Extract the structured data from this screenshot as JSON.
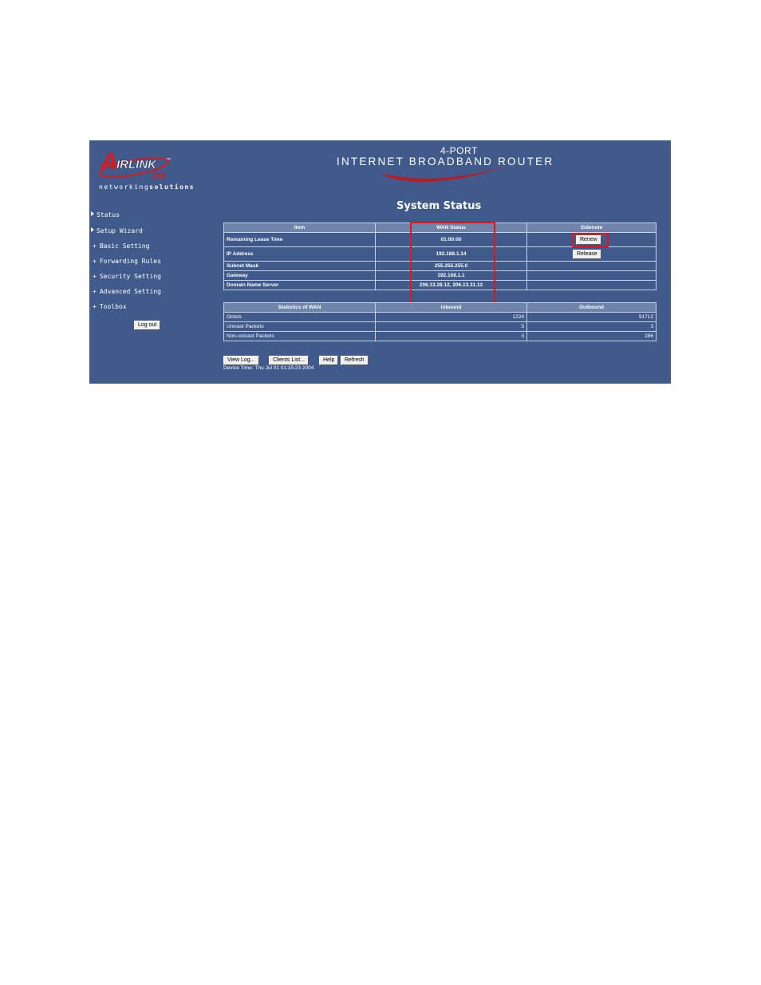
{
  "brand": {
    "logo_letters_a": "A",
    "logo_letters_irlink": "IRLINK",
    "logo_tm": "™",
    "logo_num": "101",
    "tagline_prefix": "networking",
    "tagline_suffix": "solutions",
    "banner_small": "4-PORT",
    "banner_big": "INTERNET BROADBAND ROUTER"
  },
  "nav": {
    "items": [
      {
        "label": "Status",
        "marker": "triangle"
      },
      {
        "label": "Setup Wizard",
        "marker": "triangle"
      },
      {
        "label": "Basic Setting",
        "marker": "+"
      },
      {
        "label": "Forwarding Rules",
        "marker": "+"
      },
      {
        "label": "Security Setting",
        "marker": "+"
      },
      {
        "label": "Advanced Setting",
        "marker": "+"
      },
      {
        "label": "Toolbox",
        "marker": "+"
      }
    ],
    "logout_label": "Log out"
  },
  "main": {
    "title": "System Status",
    "wan_table": {
      "headers": [
        "Item",
        "WAN Status",
        "Sidenote"
      ],
      "rows": [
        {
          "item": "Remaining Lease Time",
          "value": "01:00:00"
        },
        {
          "item": "IP Address",
          "value": "192.168.1.14"
        },
        {
          "item": "Subnet Mask",
          "value": "255.255.255.0"
        },
        {
          "item": "Gateway",
          "value": "192.168.1.1"
        },
        {
          "item": "Domain Name Server",
          "value": "206.13.28.12, 206.13.31.12"
        }
      ],
      "renew_label": "Renew",
      "release_label": "Release"
    },
    "stats_table": {
      "headers": [
        "Statistics of WAN",
        "Inbound",
        "Outbound"
      ],
      "rows": [
        {
          "label": "Octets",
          "inbound": "1224",
          "outbound": "91712"
        },
        {
          "label": "Unicast Packets",
          "inbound": "5",
          "outbound": "3"
        },
        {
          "label": "Non-unicast Packets",
          "inbound": "3",
          "outbound": "286"
        }
      ]
    },
    "buttons": {
      "view_log": "View Log...",
      "clients_list": "Clients List...",
      "help": "Help",
      "refresh": "Refresh"
    },
    "device_time_label": "Device Time:",
    "device_time_value": "Thu Jul 01 01:15:23 2004"
  },
  "colors": {
    "page_bg": "#3f5a8b",
    "header_row": "#6e84ab",
    "highlight": "#e3151b"
  }
}
